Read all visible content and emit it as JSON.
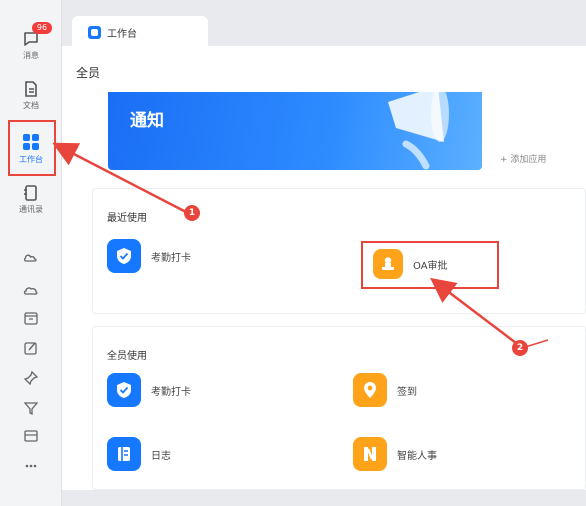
{
  "sidebar": {
    "items": [
      {
        "label": "消息",
        "badge": "96"
      },
      {
        "label": "文档"
      },
      {
        "label": "工作台"
      },
      {
        "label": "通讯录"
      }
    ],
    "tools": [
      "cloud-icon",
      "calendar-icon",
      "edit-icon",
      "pin-icon",
      "filter-icon",
      "box-icon",
      "more-icon"
    ]
  },
  "tab": {
    "title": "工作台"
  },
  "main": {
    "section_title": "全员",
    "banner": {
      "title": "通知"
    },
    "add_link": "+ 添加应用",
    "recent": {
      "title": "最近使用",
      "apps": [
        {
          "label": "考勤打卡",
          "color": "#1677ff"
        },
        {
          "label": "OA审批",
          "color": "#ffa31a"
        }
      ]
    },
    "all": {
      "title": "全员使用",
      "apps": [
        {
          "label": "考勤打卡",
          "color": "#1677ff"
        },
        {
          "label": "签到",
          "color": "#ffa31a"
        },
        {
          "label": "日志",
          "color": "#1677ff"
        },
        {
          "label": "智能人事",
          "color": "#ffa31a"
        }
      ]
    }
  },
  "annotations": [
    {
      "number": "1"
    },
    {
      "number": "2"
    }
  ],
  "colors": {
    "accent": "#1677ff",
    "highlight": "#e8463c",
    "orange": "#ffa31a"
  }
}
